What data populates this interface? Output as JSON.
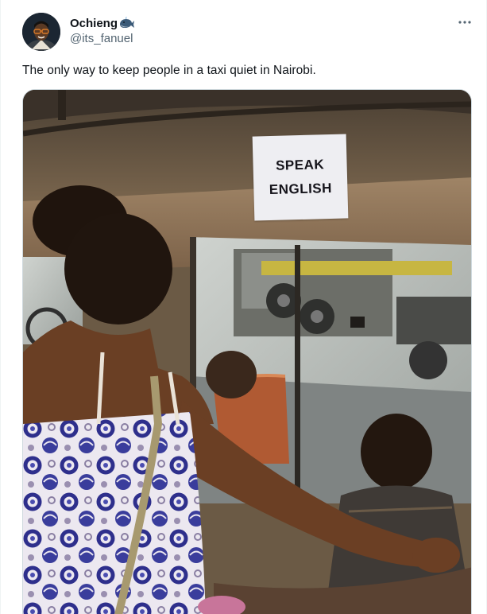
{
  "tweet": {
    "author": {
      "display_name": "Ochieng",
      "handle": "@its_fanuel",
      "flair_icon": "whale-emoji-icon"
    },
    "menu_icon": "more-horizontal-icon",
    "text": "The only way to keep people in a taxi quiet in Nairobi.",
    "media": {
      "sign_lines": [
        "SPEAK",
        "ENGLISH"
      ]
    }
  },
  "colors": {
    "text_primary": "#0f1419",
    "text_secondary": "#536471",
    "border": "#cfd9de"
  }
}
